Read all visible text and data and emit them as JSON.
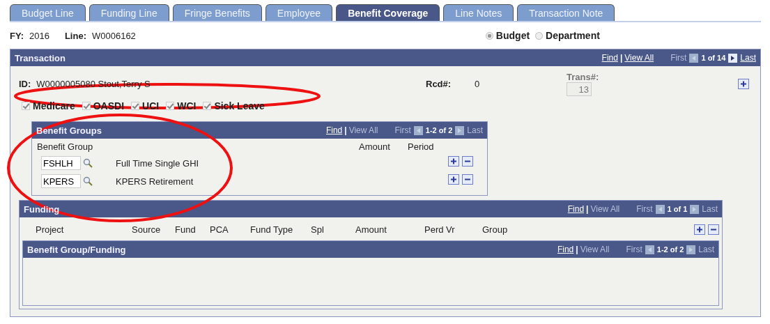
{
  "tabs": [
    {
      "label": "Budget Line",
      "selected": false
    },
    {
      "label": "Funding Line",
      "selected": false
    },
    {
      "label": "Fringe Benefits",
      "selected": false
    },
    {
      "label": "Employee",
      "selected": false
    },
    {
      "label": "Benefit Coverage",
      "selected": true
    },
    {
      "label": "Line Notes",
      "selected": false
    },
    {
      "label": "Transaction Note",
      "selected": false
    }
  ],
  "header": {
    "fy_label": "FY:",
    "fy": "2016",
    "line_label": "Line:",
    "line": "W0006162",
    "modes": [
      {
        "label": "Budget",
        "selected": true
      },
      {
        "label": "Department",
        "selected": false
      }
    ]
  },
  "transaction": {
    "title": "Transaction",
    "nav": {
      "find": "Find",
      "separator": "|",
      "view_all": "View All",
      "view_all_enabled": true,
      "first": "First",
      "first_enabled": false,
      "prev_enabled": false,
      "range": "1 of 14",
      "next_enabled": true,
      "last": "Last",
      "last_enabled": true
    },
    "id_label": "ID:",
    "id": "W0000005080 Stout,Terry S",
    "rcd_label": "Rcd#:",
    "rcd": "0",
    "trans_label": "Trans#:",
    "trans": "13",
    "trans_disabled": true,
    "benefits": [
      {
        "label": "Medicare",
        "checked": true,
        "disabled": true
      },
      {
        "label": "OASDI",
        "checked": true,
        "disabled": true
      },
      {
        "label": "UCI",
        "checked": true,
        "disabled": true
      },
      {
        "label": "WCI",
        "checked": true,
        "disabled": true
      },
      {
        "label": "Sick Leave",
        "checked": true,
        "disabled": true
      }
    ],
    "benefit_groups": {
      "title": "Benefit Groups",
      "nav": {
        "find": "Find",
        "separator": "|",
        "view_all": "View All",
        "view_all_enabled": false,
        "first": "First",
        "first_enabled": false,
        "prev_enabled": false,
        "range": "1-2 of 2",
        "next_enabled": false,
        "last": "Last",
        "last_enabled": false
      },
      "columns": [
        "Benefit Group",
        "Amount",
        "Period"
      ],
      "rows": [
        {
          "code": "FSHLH",
          "description": "Full Time Single GHI"
        },
        {
          "code": "KPERS",
          "description": "KPERS Retirement"
        }
      ]
    },
    "funding": {
      "title": "Funding",
      "nav": {
        "find": "Find",
        "separator": "|",
        "view_all": "View All",
        "view_all_enabled": false,
        "first": "First",
        "first_enabled": false,
        "prev_enabled": false,
        "range": "1 of 1",
        "next_enabled": false,
        "last": "Last",
        "last_enabled": false
      },
      "columns": [
        "Project",
        "Source",
        "Fund",
        "PCA",
        "Fund Type",
        "Spl",
        "Amount",
        "Perd Vr",
        "Group"
      ],
      "sub_panel": {
        "title": "Benefit Group/Funding",
        "nav": {
          "find": "Find",
          "separator": "|",
          "view_all": "View All",
          "view_all_enabled": false,
          "first": "First",
          "first_enabled": false,
          "prev_enabled": false,
          "range": "1-2 of 2",
          "next_enabled": false,
          "last": "Last",
          "last_enabled": false
        }
      }
    }
  },
  "annotations": [
    {
      "kind": "ellipse"
    },
    {
      "kind": "ellipse"
    }
  ]
}
